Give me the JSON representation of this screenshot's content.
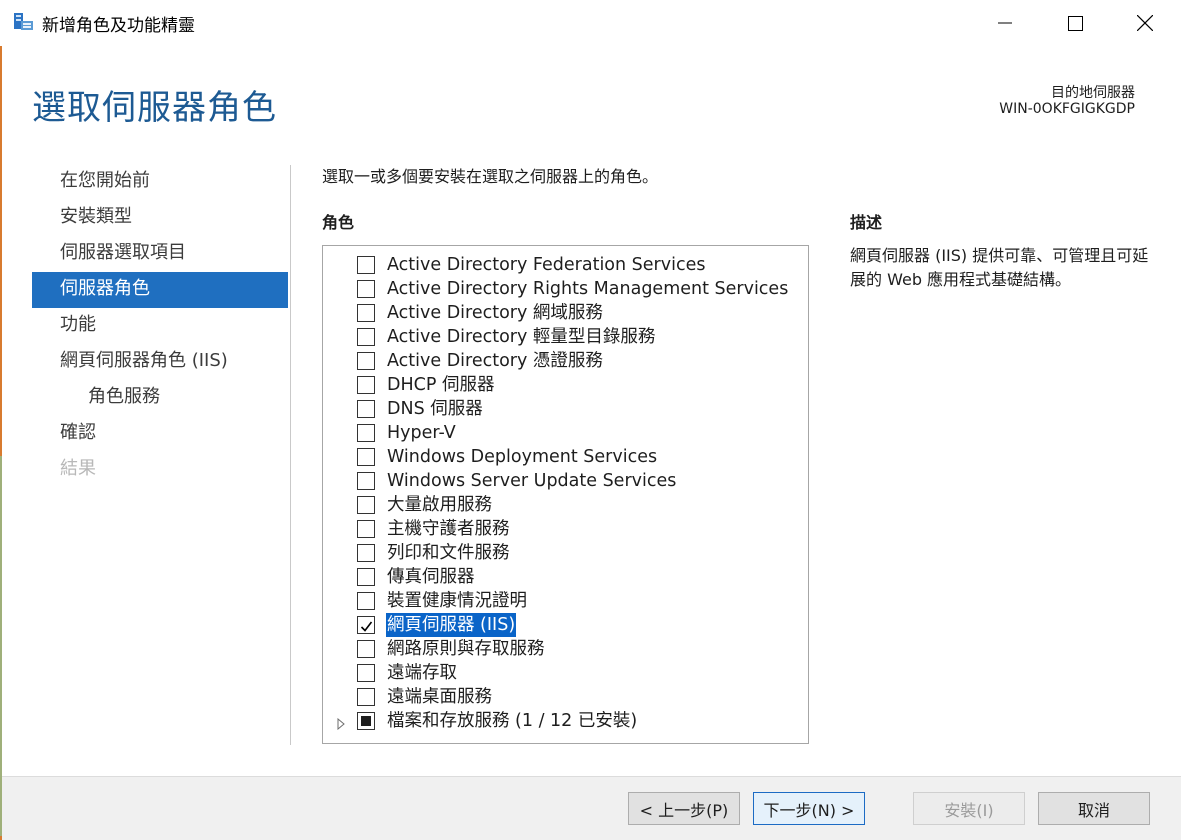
{
  "window": {
    "title": "新增角色及功能精靈",
    "controls": [
      "minimize-icon",
      "maximize-icon",
      "close-icon"
    ]
  },
  "header": {
    "page_title": "選取伺服器角色",
    "destination_label": "目的地伺服器",
    "destination_value": "WIN-0OKFGIGKGDP"
  },
  "nav": {
    "items": [
      {
        "label": "在您開始前",
        "state": "normal"
      },
      {
        "label": "安裝類型",
        "state": "normal"
      },
      {
        "label": "伺服器選取項目",
        "state": "normal"
      },
      {
        "label": "伺服器角色",
        "state": "active"
      },
      {
        "label": "功能",
        "state": "normal"
      },
      {
        "label": "網頁伺服器角色 (IIS)",
        "state": "normal"
      },
      {
        "label": "角色服務",
        "state": "sub"
      },
      {
        "label": "確認",
        "state": "normal"
      },
      {
        "label": "結果",
        "state": "disabled"
      }
    ]
  },
  "main": {
    "instruction": "選取一或多個要安裝在選取之伺服器上的角色。",
    "roles_header": "角色",
    "description_header": "描述",
    "description_text": "網頁伺服器 (IIS) 提供可靠、可管理且可延展的 Web 應用程式基礎結構。",
    "roles": [
      {
        "label": "Active Directory Federation Services",
        "state": "unchecked"
      },
      {
        "label": "Active Directory Rights Management Services",
        "state": "unchecked"
      },
      {
        "label": "Active Directory 網域服務",
        "state": "unchecked"
      },
      {
        "label": "Active Directory 輕量型目錄服務",
        "state": "unchecked"
      },
      {
        "label": "Active Directory 憑證服務",
        "state": "unchecked"
      },
      {
        "label": "DHCP 伺服器",
        "state": "unchecked"
      },
      {
        "label": "DNS 伺服器",
        "state": "unchecked"
      },
      {
        "label": "Hyper-V",
        "state": "unchecked"
      },
      {
        "label": "Windows Deployment Services",
        "state": "unchecked"
      },
      {
        "label": "Windows Server Update Services",
        "state": "unchecked"
      },
      {
        "label": "大量啟用服務",
        "state": "unchecked"
      },
      {
        "label": "主機守護者服務",
        "state": "unchecked"
      },
      {
        "label": "列印和文件服務",
        "state": "unchecked"
      },
      {
        "label": "傳真伺服器",
        "state": "unchecked"
      },
      {
        "label": "裝置健康情況證明",
        "state": "unchecked"
      },
      {
        "label": "網頁伺服器 (IIS)",
        "state": "checked",
        "selected": true
      },
      {
        "label": "網路原則與存取服務",
        "state": "unchecked"
      },
      {
        "label": "遠端存取",
        "state": "unchecked"
      },
      {
        "label": "遠端桌面服務",
        "state": "unchecked"
      },
      {
        "label": "檔案和存放服務 (1 / 12 已安裝)",
        "state": "partial",
        "expandable": true
      }
    ]
  },
  "footer": {
    "prev_label": "< 上一步(P)",
    "next_label": "下一步(N) >",
    "install_label": "安裝(I)",
    "cancel_label": "取消"
  },
  "colors": {
    "title_blue": "#1d5a93",
    "nav_active": "#1f6fc0",
    "selection": "#0a64c8"
  }
}
